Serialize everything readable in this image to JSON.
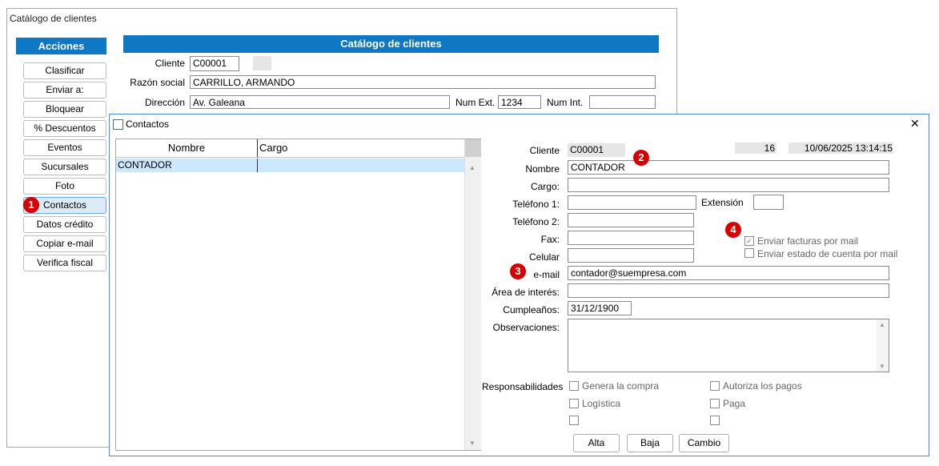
{
  "window": {
    "title": "Catálogo de clientes"
  },
  "sidebar": {
    "header": "Acciones",
    "items": [
      {
        "label": "Clasificar"
      },
      {
        "label": "Enviar a:"
      },
      {
        "label": "Bloquear"
      },
      {
        "label": "% Descuentos"
      },
      {
        "label": "Eventos"
      },
      {
        "label": "Sucursales"
      },
      {
        "label": "Foto"
      },
      {
        "label": "Contactos"
      },
      {
        "label": "Datos crédito"
      },
      {
        "label": "Copiar e-mail"
      },
      {
        "label": "Verifica fiscal"
      }
    ]
  },
  "catalog": {
    "header": "Catálogo de clientes",
    "cliente_label": "Cliente",
    "cliente_value": "C00001",
    "razon_label": "Razón social",
    "razon_value": "CARRILLO, ARMANDO",
    "direccion_label": "Dirección",
    "direccion_value": "Av. Galeana",
    "numext_label": "Num Ext.",
    "numext_value": "1234",
    "numint_label": "Num Int.",
    "numint_value": ""
  },
  "dialog": {
    "title": "Contactos",
    "close": "✕",
    "grid": {
      "columns": [
        "Nombre",
        "Cargo"
      ],
      "rows": [
        {
          "nombre": "CONTADOR",
          "cargo": ""
        }
      ]
    },
    "form": {
      "cliente_label": "Cliente",
      "cliente_value": "C00001",
      "count": "16",
      "datetime": "10/06/2025 13:14:15",
      "nombre_label": "Nombre",
      "nombre_value": "CONTADOR",
      "cargo_label": "Cargo:",
      "cargo_value": "",
      "tel1_label": "Teléfono 1:",
      "tel1_value": "",
      "ext_label": "Extensión",
      "ext_value": "",
      "tel2_label": "Teléfono 2:",
      "tel2_value": "",
      "fax_label": "Fax:",
      "fax_value": "",
      "celular_label": "Celular",
      "celular_value": "",
      "email_label": "e-mail",
      "email_value": "contador@suempresa.com",
      "area_label": "Área de interés:",
      "area_value": "",
      "cumple_label": "Cumpleaños:",
      "cumple_value": "31/12/1900",
      "obs_label": "Observaciones:",
      "obs_value": "",
      "chk_facturas": "Enviar facturas por mail",
      "chk_facturas_checked": true,
      "chk_estado": "Enviar estado de cuenta por mail",
      "chk_estado_checked": false,
      "resp_label": "Responsabilidades",
      "resp": [
        "Genera la compra",
        "Autoriza los pagos",
        "Logística",
        "Paga",
        "",
        ""
      ]
    },
    "buttons": {
      "alta": "Alta",
      "baja": "Baja",
      "cambio": "Cambio"
    }
  },
  "badges": [
    "1",
    "2",
    "3",
    "4"
  ],
  "colors": {
    "accent": "#0e78c4",
    "badge": "#d40000",
    "selection": "#cce8ff"
  }
}
